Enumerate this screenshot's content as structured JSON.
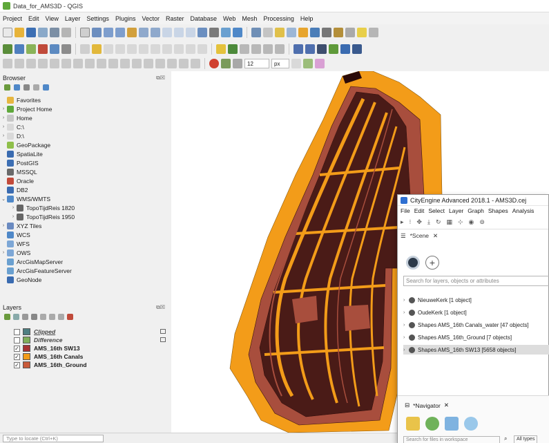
{
  "window": {
    "title": "Data_for_AMS3D - QGIS"
  },
  "menu": [
    "Project",
    "Edit",
    "View",
    "Layer",
    "Settings",
    "Plugins",
    "Vector",
    "Raster",
    "Database",
    "Web",
    "Mesh",
    "Processing",
    "Help"
  ],
  "toolbar3": {
    "size_value": "12",
    "unit_value": "px"
  },
  "browser": {
    "title": "Browser",
    "items": [
      {
        "label": "Favorites",
        "icon": "star-icon",
        "arrow": ""
      },
      {
        "label": "Project Home",
        "icon": "folder-green-icon",
        "arrow": "›"
      },
      {
        "label": "Home",
        "icon": "home-folder-icon",
        "arrow": "›"
      },
      {
        "label": "C:\\",
        "icon": "drive-icon",
        "arrow": "›"
      },
      {
        "label": "D:\\",
        "icon": "drive-icon",
        "arrow": "›"
      },
      {
        "label": "GeoPackage",
        "icon": "geopackage-icon",
        "arrow": ""
      },
      {
        "label": "SpatiaLite",
        "icon": "spatialite-icon",
        "arrow": ""
      },
      {
        "label": "PostGIS",
        "icon": "postgis-icon",
        "arrow": ""
      },
      {
        "label": "MSSQL",
        "icon": "mssql-icon",
        "arrow": ""
      },
      {
        "label": "Oracle",
        "icon": "oracle-icon",
        "arrow": ""
      },
      {
        "label": "DB2",
        "icon": "db2-icon",
        "arrow": ""
      },
      {
        "label": "WMS/WMTS",
        "icon": "wms-icon",
        "arrow": "⌄"
      },
      {
        "label": "TopoTijdReis 1820",
        "icon": "wms-layer-icon",
        "arrow": "›",
        "indent": true
      },
      {
        "label": "TopoTijdReis 1950",
        "icon": "wms-layer-icon",
        "arrow": "›",
        "indent": true
      },
      {
        "label": "XYZ Tiles",
        "icon": "xyz-icon",
        "arrow": "›"
      },
      {
        "label": "WCS",
        "icon": "wcs-icon",
        "arrow": ""
      },
      {
        "label": "WFS",
        "icon": "wfs-icon",
        "arrow": ""
      },
      {
        "label": "OWS",
        "icon": "ows-icon",
        "arrow": "›"
      },
      {
        "label": "ArcGisMapServer",
        "icon": "arcgis-map-icon",
        "arrow": ""
      },
      {
        "label": "ArcGisFeatureServer",
        "icon": "arcgis-feature-icon",
        "arrow": ""
      },
      {
        "label": "GeoNode",
        "icon": "geonode-icon",
        "arrow": ""
      }
    ]
  },
  "layers": {
    "title": "Layers",
    "items": [
      {
        "label": "Clipped",
        "checked": "",
        "color": "#4f7f82",
        "italic": true,
        "underline": true
      },
      {
        "label": "Difference",
        "checked": "",
        "color": "#7fae5a",
        "italic": true
      },
      {
        "label": "AMS_16th SW13",
        "checked": "✓",
        "color": "#a83232"
      },
      {
        "label": "AMS_16th Canals",
        "checked": "✓",
        "color": "#f39c19"
      },
      {
        "label": "AMS_16th_Ground",
        "checked": "✓",
        "color": "#c85a3a"
      }
    ]
  },
  "status": {
    "locator_placeholder": "Type to locate (Ctrl+K)"
  },
  "cityengine": {
    "title": "CityEngine Advanced 2018.1 - AMS3D.cej",
    "menu": [
      "File",
      "Edit",
      "Select",
      "Layer",
      "Graph",
      "Shapes",
      "Analysis"
    ],
    "scene_tab": "*Scene",
    "search_placeholder": "Search for layers, objects or attributes",
    "scene_items": [
      "NieuweKerk [1 object]",
      "OudeKerk [1 object]",
      "Shapes AMS_16th Canals_water [47 objects]",
      "Shapes AMS_16th_Ground [7 objects]",
      "Shapes AMS_16th SW13 [5658 objects]"
    ],
    "navigator_tab": "*Navigator",
    "navigator_search": "Search for files in workspace",
    "navigator_filter": "All types"
  },
  "colors": {
    "canal_orange": "#f39c19",
    "building_dark": "#4a1b17",
    "ground_brown": "#a84e3d",
    "qgis_green": "#5fa83b"
  }
}
